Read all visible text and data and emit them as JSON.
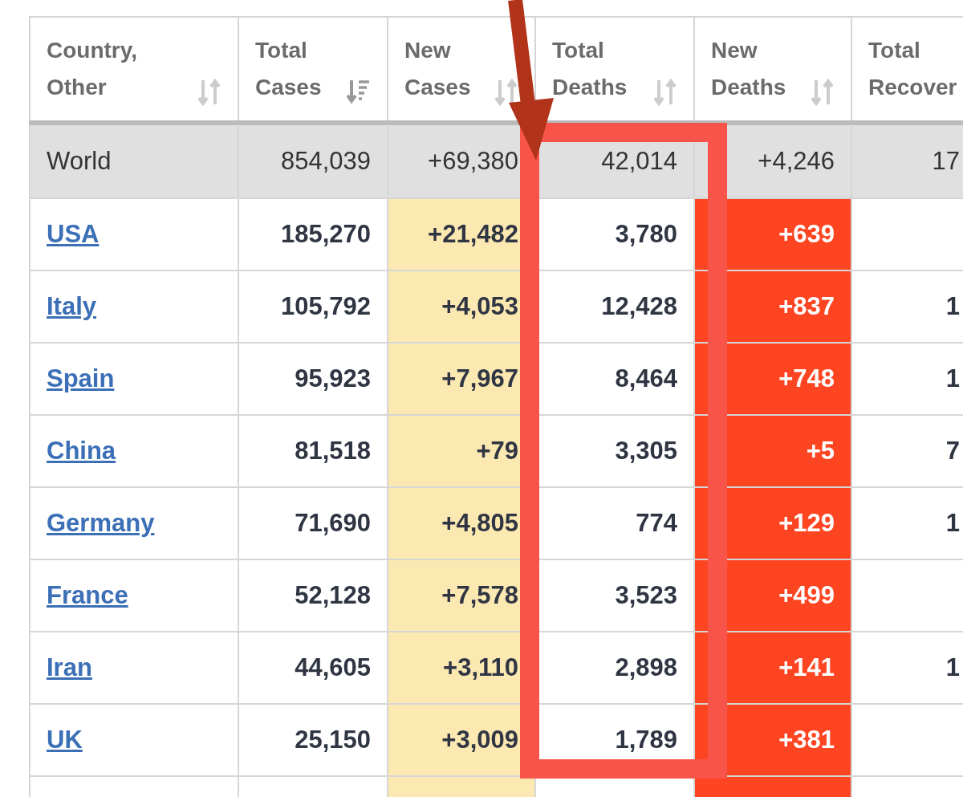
{
  "table": {
    "columns": [
      {
        "label": "Country, Other",
        "sorted": false
      },
      {
        "label": "Total Cases",
        "sorted": true
      },
      {
        "label": "New Cases",
        "sorted": false,
        "color": "#fce9b2"
      },
      {
        "label": "Total Deaths",
        "sorted": false
      },
      {
        "label": "New Deaths",
        "sorted": false,
        "color": "#fd4522"
      },
      {
        "label": "Total Recover"
      }
    ],
    "rows": [
      {
        "kind": "total",
        "cells": [
          "World",
          "854,039",
          "+69,380",
          "42,014",
          "+4,246",
          "17"
        ]
      },
      {
        "kind": "country",
        "cells": [
          "USA",
          "185,270",
          "+21,482",
          "3,780",
          "+639",
          null
        ]
      },
      {
        "kind": "country",
        "cells": [
          "Italy",
          "105,792",
          "+4,053",
          "12,428",
          "+837",
          "1"
        ]
      },
      {
        "kind": "country",
        "cells": [
          "Spain",
          "95,923",
          "+7,967",
          "8,464",
          "+748",
          "1"
        ]
      },
      {
        "kind": "country",
        "cells": [
          "China",
          "81,518",
          "+79",
          "3,305",
          "+5",
          "7"
        ]
      },
      {
        "kind": "country",
        "cells": [
          "Germany",
          "71,690",
          "+4,805",
          "774",
          "+129",
          "1"
        ]
      },
      {
        "kind": "country",
        "cells": [
          "France",
          "52,128",
          "+7,578",
          "3,523",
          "+499",
          null
        ]
      },
      {
        "kind": "country",
        "cells": [
          "Iran",
          "44,605",
          "+3,110",
          "2,898",
          "+141",
          "1"
        ]
      },
      {
        "kind": "country",
        "cells": [
          "UK",
          "25,150",
          "+3,009",
          "1,789",
          "+381",
          null
        ]
      }
    ]
  },
  "annotations": [
    {
      "kind": "frame"
    },
    {
      "kind": "arrow"
    }
  ]
}
